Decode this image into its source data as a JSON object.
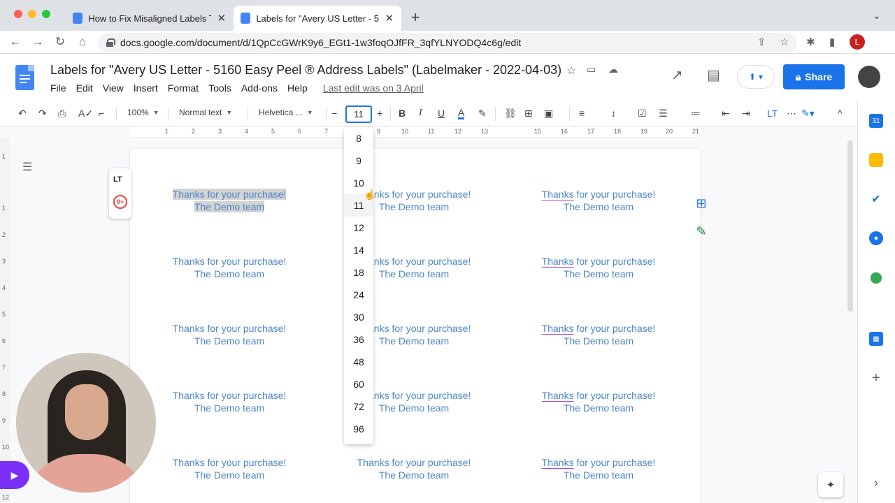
{
  "browser": {
    "tabs": [
      {
        "title": "How to Fix Misaligned Labels T",
        "close": "✕"
      },
      {
        "title": "Labels for \"Avery US Letter - 5",
        "close": "✕"
      }
    ],
    "new_tab": "+",
    "url": "docs.google.com/document/d/1QpCcGWrK9y6_EGt1-1w3foqOJfFR_3qfYLNYODQ4c6g/edit",
    "profile_initial": "L"
  },
  "doc": {
    "title": "Labels for \"Avery US Letter - 5160 Easy Peel ® Address Labels\" (Labelmaker - 2022-04-03)",
    "menus": [
      "File",
      "Edit",
      "View",
      "Insert",
      "Format",
      "Tools",
      "Add-ons",
      "Help"
    ],
    "last_edit": "Last edit was on 3 April",
    "share_label": "Share"
  },
  "toolbar": {
    "zoom": "100%",
    "style": "Normal text",
    "font": "Helvetica ...",
    "font_size": "11",
    "minus": "−",
    "plus": "+"
  },
  "ruler": {
    "marks": [
      "1",
      "2",
      "3",
      "4",
      "5",
      "6",
      "7",
      "9",
      "10",
      "11",
      "12",
      "13",
      "15",
      "16",
      "17",
      "18",
      "19",
      "20",
      "21"
    ],
    "vmarks": [
      "1",
      "1",
      "2",
      "3",
      "4",
      "5",
      "6",
      "7",
      "8",
      "9",
      "10",
      "11",
      "12"
    ]
  },
  "font_size_dropdown": {
    "options": [
      "8",
      "9",
      "10",
      "11",
      "12",
      "14",
      "18",
      "24",
      "30",
      "36",
      "48",
      "60",
      "72",
      "96"
    ],
    "selected": "11"
  },
  "labels": {
    "line1": "Thanks for your purchase!",
    "line1_cut": "nks for your purchase!",
    "line1_word": "Thanks",
    "line1_rest": " for your purchase!",
    "line2": "The Demo team"
  },
  "addon": {
    "lt": "LT",
    "badge": "9+"
  },
  "icons": {
    "back": "←",
    "forward": "→",
    "reload": "↻",
    "home": "⌂",
    "undo": "↶",
    "redo": "↷",
    "print": "⎙",
    "bold": "B",
    "italic": "I",
    "underline": "U",
    "text_color": "A",
    "more": "⋯",
    "collapse": "^",
    "chevron": "⌄",
    "add": "+",
    "next": "›",
    "star": "☆"
  },
  "colors": {
    "accent": "#1a73e8",
    "label_text": "#4a86c8",
    "rec": "#7b2ff7"
  }
}
